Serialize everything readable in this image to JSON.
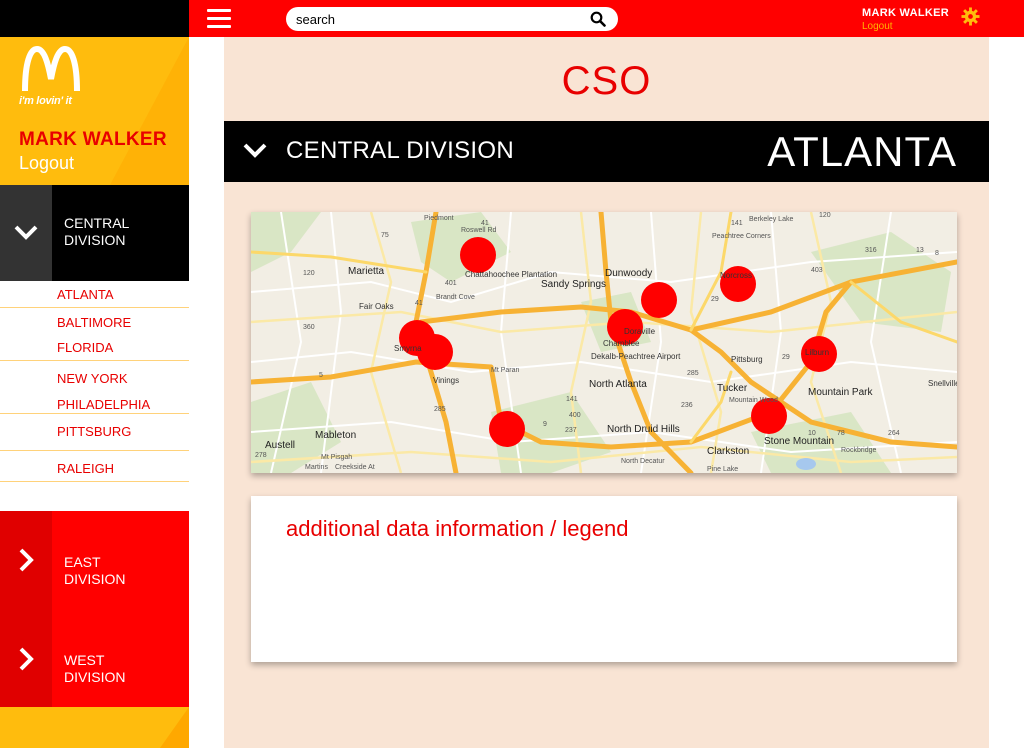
{
  "header": {
    "search_placeholder": "search",
    "user_name": "MARK WALKER",
    "logout_label": "Logout"
  },
  "sidebar": {
    "tagline": "i'm lovin' it",
    "user_name": "MARK WALKER",
    "logout_label": "Logout",
    "central": {
      "label_line1": "CENTRAL",
      "label_line2": "DIVISION",
      "cities": [
        "ATLANTA",
        "BALTIMORE",
        "FLORIDA",
        "NEW YORK",
        "PHILADELPHIA",
        "PITTSBURG",
        "RALEIGH"
      ]
    },
    "east": {
      "label_line1": "EAST",
      "label_line2": "DIVISION"
    },
    "west": {
      "label_line1": "WEST",
      "label_line2": "DIVISION"
    }
  },
  "main": {
    "title": "CSO",
    "division_title": "CENTRAL DIVISION",
    "city_title": "ATLANTA",
    "legend_text": "additional data information / legend"
  },
  "map": {
    "places": [
      "Marietta",
      "Sandy Springs",
      "Dunwoody",
      "Norcross",
      "Chattahoochee Plantation",
      "Fair Oaks",
      "Smyrna",
      "Vinings",
      "Doraville",
      "Chamblee",
      "Dekalb-Peachtree Airport",
      "North Atlanta",
      "Tucker",
      "Lilburn",
      "Mountain Park",
      "Pittsburg",
      "Mableton",
      "Austell",
      "North Druid Hills",
      "Clarkston",
      "Stone Mountain",
      "Snellville",
      "Peachtree Corners",
      "Berkeley Lake",
      "Brandt Cove",
      "Mt Paran",
      "Mountain Wood",
      "Creekside At",
      "North Decatur",
      "Pine Lake",
      "Rockbridge",
      "Mt Pisgah",
      "Martins",
      "Roswell Rd",
      "Piedmont"
    ],
    "road_numbers": [
      "75",
      "120",
      "401",
      "41",
      "5",
      "360",
      "285",
      "141",
      "400",
      "237",
      "9",
      "29",
      "78",
      "10",
      "264",
      "236",
      "316",
      "403",
      "8",
      "278",
      "120",
      "141",
      "13",
      "285",
      "29",
      "41"
    ],
    "accent": "#ff0000"
  }
}
